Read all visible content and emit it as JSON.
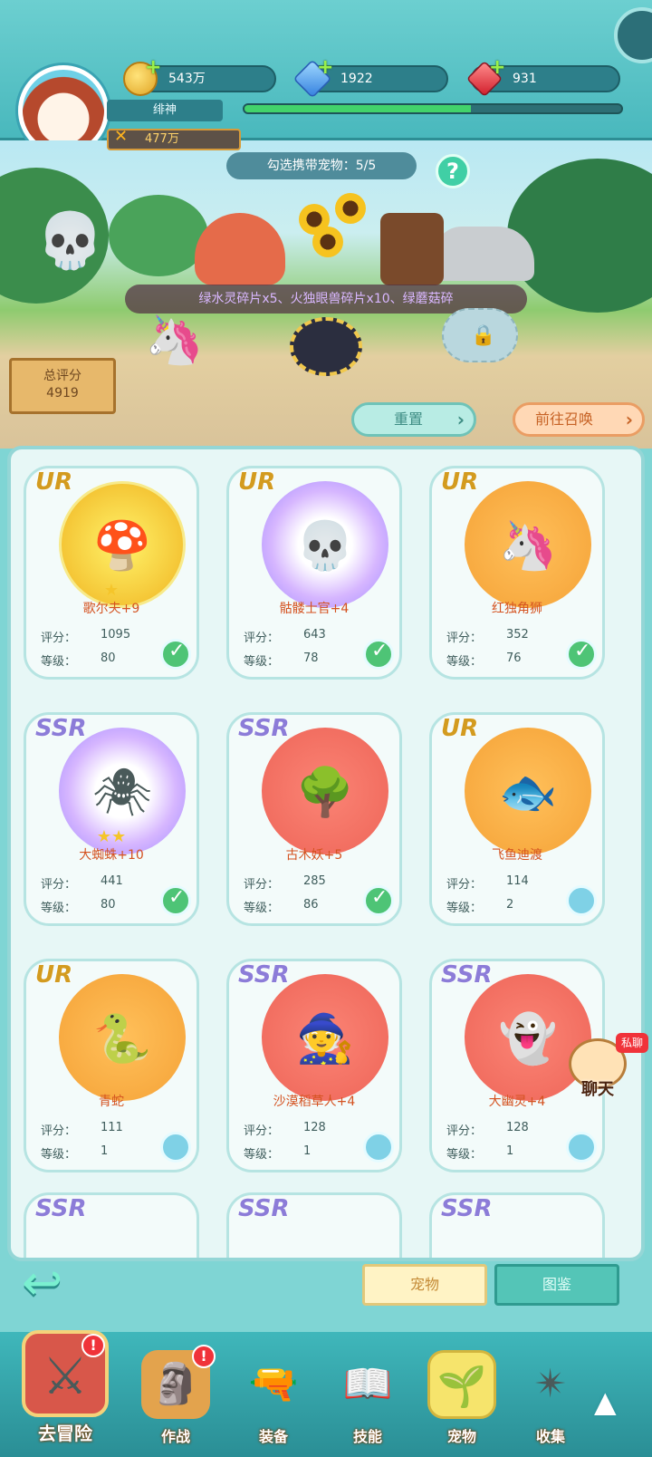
{
  "hud": {
    "gold": "543万",
    "gems": "1922",
    "rubies": "931",
    "player_name": "绯神",
    "power": "477万",
    "exp_progress": 0.6
  },
  "scene": {
    "select_label": "勾选携带宠物：5/5",
    "help_icon": "question-icon",
    "fragments_text": "绿水灵碎片x5、火独眼兽碎片x10、绿蘑菇碎",
    "score_label": "总评分",
    "score_value": "4919",
    "reset_label": "重置",
    "summon_label": "前往召唤"
  },
  "pets": [
    {
      "rarity": "UR",
      "name": "歌尔夫+9",
      "score_label": "评分：",
      "score": "1095",
      "level_label": "等级：",
      "level": "80",
      "stars": "★",
      "checked": true
    },
    {
      "rarity": "UR",
      "name": "骷髅士官+4",
      "score_label": "评分：",
      "score": "643",
      "level_label": "等级：",
      "level": "78",
      "stars": "",
      "checked": true
    },
    {
      "rarity": "UR",
      "name": "红独角狮",
      "score_label": "评分：",
      "score": "352",
      "level_label": "等级：",
      "level": "76",
      "stars": "",
      "checked": true
    },
    {
      "rarity": "SSR",
      "name": "大蜘蛛+10",
      "score_label": "评分：",
      "score": "441",
      "level_label": "等级：",
      "level": "80",
      "stars": "★★",
      "checked": true
    },
    {
      "rarity": "SSR",
      "name": "古木妖+5",
      "score_label": "评分：",
      "score": "285",
      "level_label": "等级：",
      "level": "86",
      "stars": "",
      "checked": true
    },
    {
      "rarity": "UR",
      "name": "飞鱼迪渡",
      "score_label": "评分：",
      "score": "114",
      "level_label": "等级：",
      "level": "2",
      "stars": "",
      "checked": false
    },
    {
      "rarity": "UR",
      "name": "青蛇",
      "score_label": "评分：",
      "score": "111",
      "level_label": "等级：",
      "level": "1",
      "stars": "",
      "checked": false
    },
    {
      "rarity": "SSR",
      "name": "沙漠稻草人+4",
      "score_label": "评分：",
      "score": "128",
      "level_label": "等级：",
      "level": "1",
      "stars": "",
      "checked": false
    },
    {
      "rarity": "SSR",
      "name": "大幽灵+4",
      "score_label": "评分：",
      "score": "128",
      "level_label": "等级：",
      "level": "1",
      "stars": "",
      "checked": false
    }
  ],
  "peek_rarity": "SSR",
  "tabs": {
    "pet": "宠物",
    "book": "图鉴"
  },
  "chat": {
    "tag": "私聊",
    "label": "聊天"
  },
  "nav": {
    "adventure": "去冒险",
    "battle": "作战",
    "equip": "装备",
    "skill": "技能",
    "pet": "宠物",
    "collect": "收集",
    "badge": "!"
  }
}
